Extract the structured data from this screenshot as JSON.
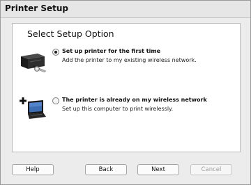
{
  "window": {
    "title": "Printer Setup"
  },
  "panel": {
    "heading": "Select Setup Option"
  },
  "options": [
    {
      "label": "Set up printer for the first time",
      "description": "Add the printer to my existing wireless network.",
      "selected": true,
      "icon": "printer-wrench-icon"
    },
    {
      "label": "The printer is already on my wireless network",
      "description": "Set up this computer to print wirelessly.",
      "selected": false,
      "icon": "add-laptop-icon"
    }
  ],
  "buttons": {
    "help": "Help",
    "back": "Back",
    "next": "Next",
    "cancel": "Cancel"
  },
  "colors": {
    "window_bg": "#ececec",
    "panel_bg": "#ffffff",
    "disabled_text": "#9e9e9e"
  }
}
